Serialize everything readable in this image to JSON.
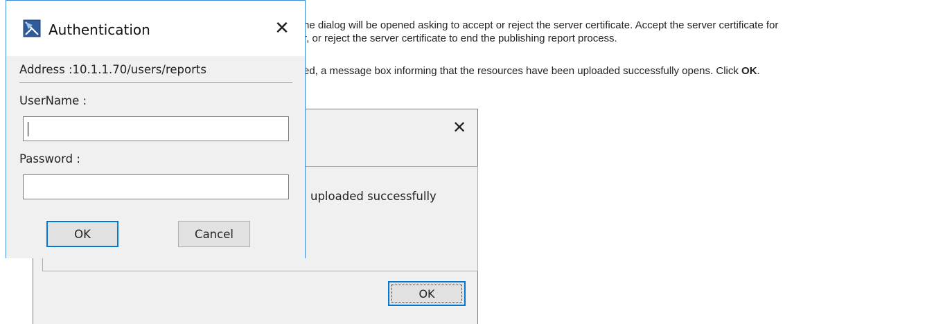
{
  "document": {
    "line1": "he dialog will be opened asking to accept or reject the server certificate. Accept the server certificate for",
    "line2": "r, or reject the server certificate to end the publishing report process.",
    "line3_prefix": "ed, a message box informing that the resources have been uploaded successfully opens. Click ",
    "line3_bold": "OK",
    "line3_suffix": "."
  },
  "message_dialog": {
    "close_glyph": "✕",
    "message": "uploaded successfully",
    "ok_label": "OK"
  },
  "auth_dialog": {
    "title": "Authentication",
    "close_glyph": "✕",
    "address": "Address :10.1.1.70/users/reports",
    "username_label": "UserName :",
    "username_value": "",
    "password_label": "Password :",
    "password_value": "",
    "ok_label": "OK",
    "cancel_label": "Cancel",
    "icon": "app-logo-icon",
    "accent_color": "#0078d7"
  }
}
